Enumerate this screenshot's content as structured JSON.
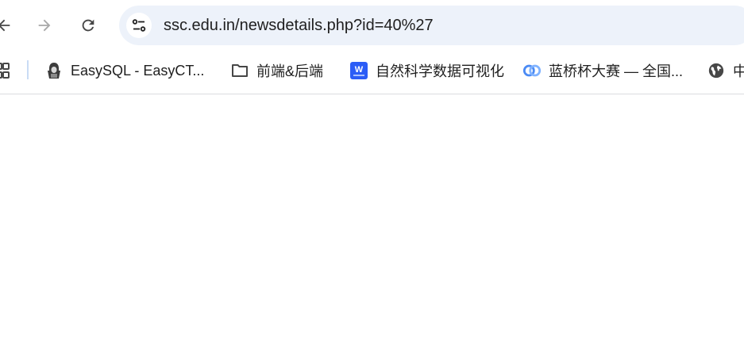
{
  "navigation": {
    "back_icon": "arrow-left-icon",
    "forward_icon": "arrow-right-icon",
    "reload_icon": "reload-icon"
  },
  "omnibox": {
    "site_info_icon": "tune-icon",
    "url": "ssc.edu.in/newsdetails.php?id=40%27"
  },
  "bookmarks": {
    "apps_icon": "apps-grid-icon",
    "items": [
      {
        "label": "EasySQL - EasyCT...",
        "icon": "hacker-avatar-icon"
      },
      {
        "label": "前端&后端",
        "icon": "folder-icon"
      },
      {
        "label": "自然科学数据可视化",
        "icon": "word-doc-icon"
      },
      {
        "label": "蓝桥杯大赛 — 全国...",
        "icon": "lanqiao-logo-icon"
      },
      {
        "label": "中",
        "icon": "globe-icon"
      }
    ]
  },
  "colors": {
    "omnibox_bg": "#edf2fa",
    "icon_gray": "#474747",
    "word_blue": "#2b5cf6",
    "divider": "#dadce0"
  }
}
